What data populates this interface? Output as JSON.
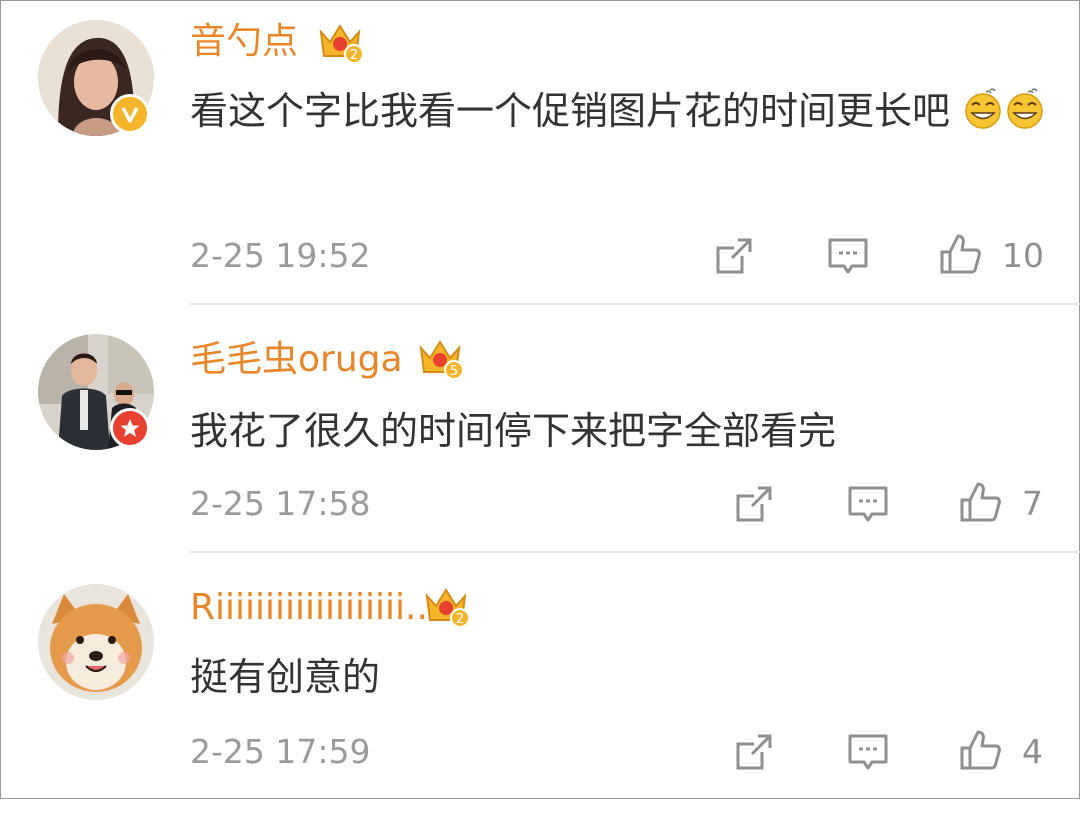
{
  "comments": [
    {
      "username": "音勺点",
      "level": "2",
      "text": "看这个字比我看一个促销图片花的时间更长吧",
      "time": "2-25 19:52",
      "likes": "10",
      "badge": "verified-v"
    },
    {
      "username": "毛毛虫oruga",
      "level": "5",
      "text": "我花了很久的时间停下来把字全部看完",
      "time": "2-25 17:58",
      "likes": "7",
      "badge": "star"
    },
    {
      "username": "Riiiiiiiiiiiiiiiiiii...",
      "level": "2",
      "text": "挺有创意的",
      "time": "2-25 17:59",
      "likes": "4",
      "badge": ""
    }
  ],
  "icons": {
    "share": "share-icon",
    "comment": "comment-icon",
    "like": "thumbs-up-icon",
    "crown": "crown-level-icon",
    "emoji": "sweat-smile-emoji-icon"
  },
  "colors": {
    "username": "#e8862a",
    "text": "#333333",
    "meta": "#9b9b9b",
    "crown": "#f5b52b",
    "divider": "#e6e6e6"
  }
}
